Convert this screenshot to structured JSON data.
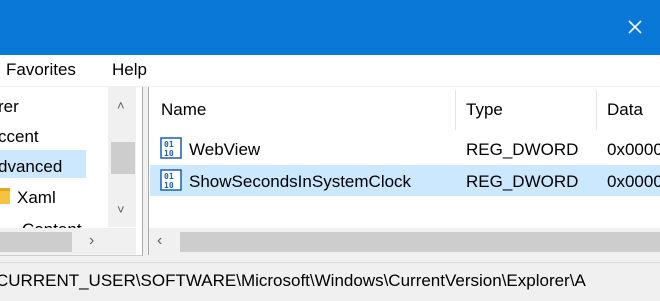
{
  "menu": {
    "favorites_label": "Favorites",
    "help_label": "Help"
  },
  "tree": {
    "items": [
      {
        "label": "rer",
        "icon": "none"
      },
      {
        "label": "ccent",
        "icon": "none"
      },
      {
        "label": "dvanced",
        "icon": "none",
        "selected": true
      },
      {
        "label": "Xaml",
        "icon": "folder-icon"
      },
      {
        "label": "Content",
        "icon": "none"
      }
    ]
  },
  "list": {
    "columns": {
      "name": "Name",
      "type": "Type",
      "data": "Data"
    },
    "rows": [
      {
        "name": "WebView",
        "type": "REG_DWORD",
        "data": "0x0000",
        "icon": "reg-binary-icon"
      },
      {
        "name": "ShowSecondsInSystemClock",
        "type": "REG_DWORD",
        "data": "0x0000",
        "icon": "reg-binary-icon",
        "selected": true
      }
    ]
  },
  "status": {
    "path": "CURRENT_USER\\SOFTWARE\\Microsoft\\Windows\\CurrentVersion\\Explorer\\A"
  },
  "colors": {
    "titlebar": "#0a78d7",
    "selection": "#cce8ff",
    "icon_blue": "#1a5fb4"
  }
}
